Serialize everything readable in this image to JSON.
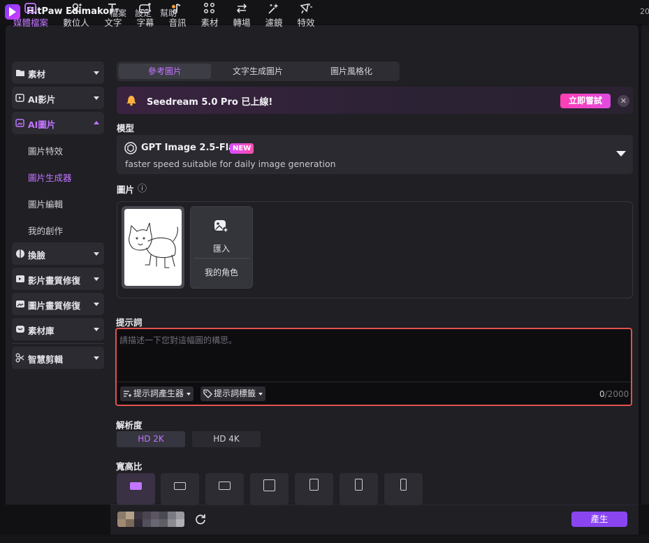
{
  "app": {
    "title": "HitPaw Edimakor"
  },
  "menu": {
    "items": [
      "檔案",
      "設定",
      "幫助"
    ],
    "clock_fragment": "20"
  },
  "toolbar": {
    "tools": [
      {
        "label": "媒體檔案",
        "icon": "media-icon",
        "active": true
      },
      {
        "label": "數位人",
        "icon": "digital-human-icon"
      },
      {
        "label": "文字",
        "icon": "text-icon"
      },
      {
        "label": "字幕",
        "icon": "subtitle-icon"
      },
      {
        "label": "音訊",
        "icon": "music-icon"
      },
      {
        "label": "素材",
        "icon": "assets-icon"
      },
      {
        "label": "轉場",
        "icon": "transition-icon"
      },
      {
        "label": "濾鏡",
        "icon": "filter-icon"
      },
      {
        "label": "特效",
        "icon": "effects-icon"
      }
    ]
  },
  "sidebar": {
    "items": [
      {
        "label": "素材",
        "icon": "folder-icon"
      },
      {
        "label": "AI影片",
        "icon": "ai-video-icon"
      },
      {
        "label": "AI圖片",
        "icon": "ai-image-icon",
        "open": true
      },
      {
        "label": "換臉",
        "icon": "face-swap-icon"
      },
      {
        "label": "影片畫質修復",
        "icon": "video-enhance-icon"
      },
      {
        "label": "圖片畫質修復",
        "icon": "image-enhance-icon"
      },
      {
        "label": "素材庫",
        "icon": "library-icon"
      },
      {
        "label": "智慧剪輯",
        "icon": "smart-edit-icon"
      }
    ],
    "sub_items": [
      {
        "label": "圖片特效"
      },
      {
        "label": "圖片生成器",
        "active": true
      },
      {
        "label": "圖片編輯"
      },
      {
        "label": "我的創作"
      }
    ]
  },
  "main": {
    "tabs": [
      {
        "label": "參考圖片",
        "active": true
      },
      {
        "label": "文字生成圖片"
      },
      {
        "label": "圖片風格化"
      }
    ],
    "banner": {
      "text": "Seedream 5.0 Pro 已上線!",
      "button": "立即嘗試",
      "close": "✕"
    },
    "model": {
      "section_label": "模型",
      "name": "GPT Image 2.5-Flare",
      "badge": "NEW",
      "description": "faster speed suitable for daily image generation"
    },
    "image": {
      "section_label": "圖片",
      "info_icon": "ⓘ",
      "import_label": "匯入",
      "role_label": "我的角色"
    },
    "prompt": {
      "section_label": "提示詞",
      "placeholder": "請描述一下您對這幅圖的構思。",
      "value": "",
      "generator_label": "提示詞產生器",
      "tags_label": "提示詞標籤",
      "count": "0",
      "max": "/2000"
    },
    "resolution": {
      "section_label": "解析度",
      "options": [
        {
          "label": "HD 2K",
          "active": true
        },
        {
          "label": "HD 4K"
        }
      ]
    },
    "aspect": {
      "section_label": "寬高比",
      "options": [
        "1:1",
        "4:3",
        "16:9",
        "1:1",
        "3:4",
        "2:3",
        "9:16"
      ],
      "selected_index": 0
    },
    "footer": {
      "generate_label": "產生"
    }
  },
  "colors": {
    "accent": "#c275ff",
    "generate": "#8a45f0",
    "banner_button": "#ff3fb3",
    "prompt_border": "#e0524d"
  }
}
